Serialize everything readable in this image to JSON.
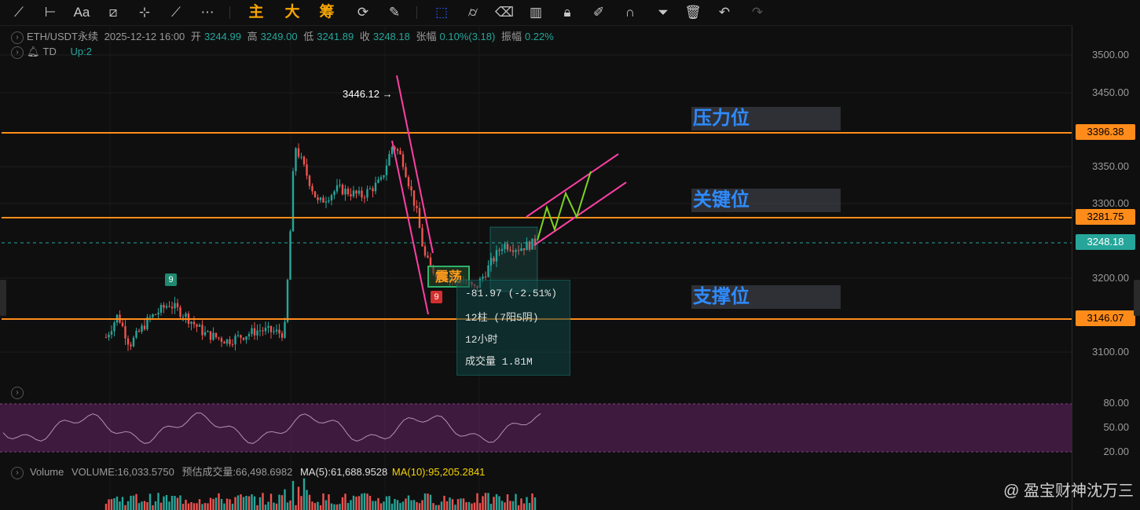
{
  "toolbar": {
    "orange_labels": [
      "主",
      "大",
      "筹"
    ]
  },
  "legend": {
    "symbol": "ETH/USDT永续",
    "datetime": "2025-12-12 16:00",
    "open_label": "开",
    "open": "3244.99",
    "high_label": "高",
    "high": "3249.00",
    "low_label": "低",
    "low": "3241.89",
    "close_label": "收",
    "close": "3248.18",
    "change_label": "张幅",
    "change": "0.10%(3.18)",
    "amp_label": "振幅",
    "amp": "0.22%",
    "indicator": "TD",
    "indicator_value": "Up:2"
  },
  "axis": {
    "ticks": [
      "3500.00",
      "3450.00",
      "3350.00",
      "3300.00",
      "3200.00",
      "3100.00"
    ],
    "rsi_ticks": [
      "80.00",
      "50.00",
      "20.00"
    ]
  },
  "price_tags": {
    "resistance": "3396.38",
    "key": "3281.75",
    "current": "3248.18",
    "support": "3146.07"
  },
  "zones": {
    "resistance": "压力位",
    "key": "关键位",
    "support": "支撑位"
  },
  "annotations": {
    "peak": "3446.12 →",
    "td_green": "9",
    "td_red": "9",
    "zhendang": "震荡"
  },
  "stats": {
    "change": "-81.97 (-2.51%)",
    "bars": "12柱 (7阳5阴)",
    "duration": "12小时",
    "volume": "成交量 1.81M"
  },
  "volume": {
    "label": "Volume",
    "value": "VOLUME:16,033.5750",
    "est": "预估成交量:66,498.6982",
    "ma5": "MA(5):61,688.9528",
    "ma10": "MA(10):95,205.2841"
  },
  "watermark": "@ 盈宝财神沈万三",
  "colors": {
    "up": "#26a69a",
    "down": "#ef5350",
    "level": "#ff8c1a",
    "channel": "#ff3fa4",
    "projection": "#7ed321"
  }
}
